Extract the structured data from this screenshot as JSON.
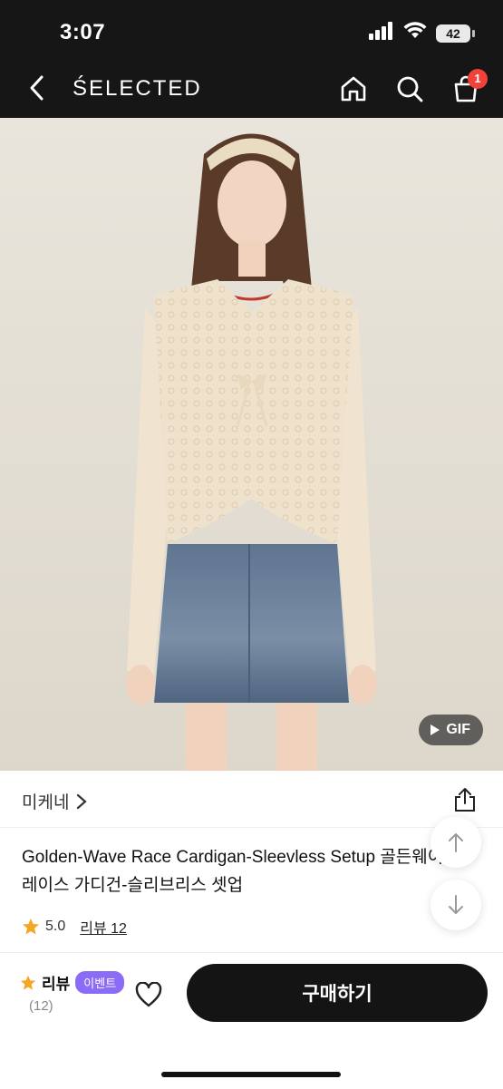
{
  "status": {
    "time": "3:07",
    "battery": "42"
  },
  "nav": {
    "brand": "ŚELECTED",
    "cart_count": "1"
  },
  "image": {
    "gif_label": "GIF"
  },
  "store": {
    "name": "미케네"
  },
  "product": {
    "title": "Golden-Wave Race Cardigan-Sleevless Setup 골든웨이브 레이스 가디건-슬리브리스 셋업",
    "rating": "5.0",
    "review_link": "리뷰 12"
  },
  "bottom": {
    "review_label": "리뷰",
    "event_label": "이벤트",
    "review_count": "(12)",
    "buy_label": "구매하기"
  },
  "colors": {
    "topbar": "#161616",
    "accent_badge": "#f0413a",
    "event_purple": "#8b6cf6",
    "star": "#f5a623"
  },
  "icons": [
    "back-icon",
    "home-icon",
    "search-icon",
    "cart-icon",
    "share-icon",
    "arrow-up-icon",
    "arrow-down-icon",
    "star-icon",
    "heart-icon",
    "play-icon",
    "wifi-icon",
    "signal-icon",
    "battery-icon"
  ]
}
